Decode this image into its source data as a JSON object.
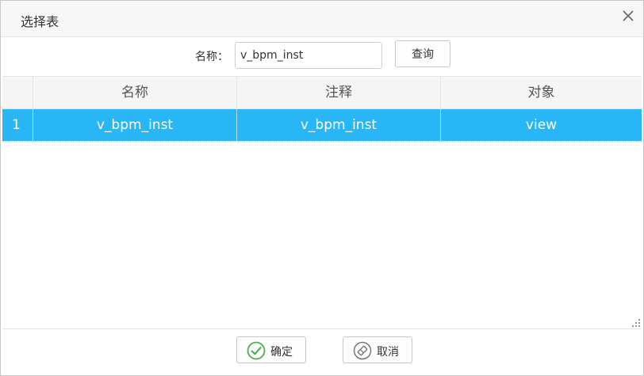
{
  "dialog": {
    "title": "选择表"
  },
  "search": {
    "label": "名称：",
    "value": "v_bpm_inst",
    "button_label": "查询"
  },
  "table": {
    "columns": [
      "名称",
      "注释",
      "对象"
    ],
    "rows": [
      {
        "index": "1",
        "name": "v_bpm_inst",
        "comment": "v_bpm_inst",
        "object": "view",
        "selected": true
      }
    ],
    "selected_color": "#29b6f6"
  },
  "footer": {
    "confirm_label": "确定",
    "cancel_label": "取消",
    "confirm_icon": "check-circle-icon",
    "cancel_icon": "eraser-icon",
    "confirm_icon_color": "#4caf50"
  }
}
